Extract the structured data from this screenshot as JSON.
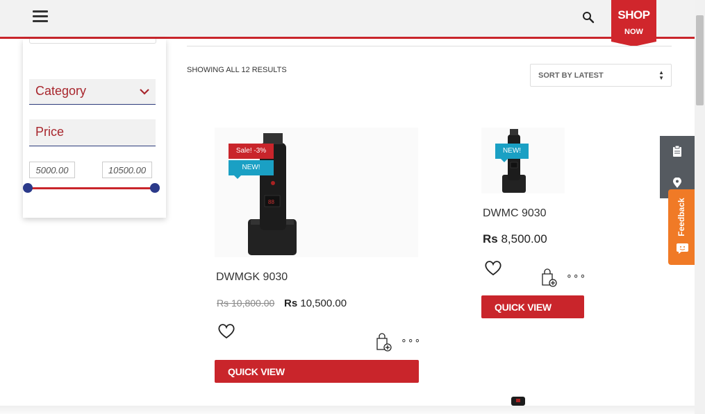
{
  "header": {
    "menu_icon": "hamburger-icon",
    "search_icon": "search-icon",
    "shop_label": "SHOP",
    "now_label": "NOW",
    "accent_color": "#c9252b"
  },
  "sidebar": {
    "category_label": "Category",
    "price_label": "Price",
    "price_min": "5000.00",
    "price_max": "10500.00"
  },
  "results": {
    "count_text": "SHOWING ALL 12 RESULTS",
    "sort_label": "SORT BY LATEST"
  },
  "products": [
    {
      "name": "DWMGK 9030",
      "sale_badge": "Sale! -3%",
      "new_badge": "NEW!",
      "old_currency": "Rs",
      "old_price": "10,800.00",
      "currency": "Rs",
      "price": "10,500.00",
      "quick_view": "QUICK VIEW"
    },
    {
      "name": "DWMC 9030",
      "new_badge": "NEW!",
      "currency": "Rs",
      "price": "8,500.00",
      "quick_view": "QUICK VIEW"
    }
  ],
  "side": {
    "feedback_label": "Feedback"
  }
}
